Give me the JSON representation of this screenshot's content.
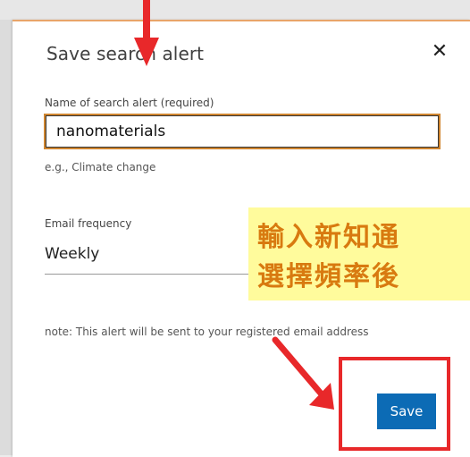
{
  "dialog": {
    "title": "Save search alert",
    "close_glyph": "✕"
  },
  "name_field": {
    "label": "Name of search alert (required)",
    "value": "nanomaterials",
    "hint": "e.g., Climate change"
  },
  "frequency": {
    "label": "Email frequency",
    "selected": "Weekly"
  },
  "note": "note: This alert will be sent to your registered email address",
  "save_label": "Save",
  "annotation": {
    "line1": "輸入新知通",
    "line2": "選擇頻率後"
  },
  "colors": {
    "accent_border": "#d08630",
    "save_button": "#0c6bb5",
    "annotation_red": "#e8282a",
    "callout_bg": "#fffb9c",
    "callout_text": "#d87a10"
  },
  "icons": {
    "close": "close-icon",
    "arrow": "arrow-icon"
  }
}
